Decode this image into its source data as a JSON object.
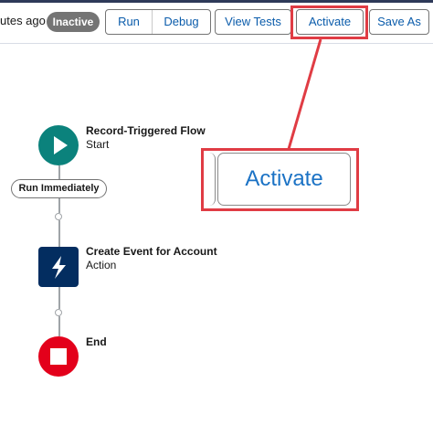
{
  "header": {
    "saved_text": "utes ago",
    "status_badge": "Inactive"
  },
  "toolbar": {
    "run_label": "Run",
    "debug_label": "Debug",
    "view_tests_label": "View Tests",
    "activate_label": "Activate",
    "save_as_label": "Save As"
  },
  "callout": {
    "activate_zoomed_label": "Activate",
    "highlight_color": "#e03c44"
  },
  "flow": {
    "start": {
      "title": "Record-Triggered Flow",
      "subtitle": "Start",
      "icon": "play-icon",
      "color": "#0b827c"
    },
    "run_immediately_label": "Run Immediately",
    "action": {
      "title": "Create Event for Account",
      "subtitle": "Action",
      "icon": "lightning-bolt-icon",
      "color": "#032d60"
    },
    "end": {
      "title": "End",
      "icon": "stop-icon",
      "color": "#e3001b"
    }
  },
  "colors": {
    "link_blue": "#0b5cab",
    "badge_gray": "#747474",
    "top_strip": "#2e3a59"
  }
}
